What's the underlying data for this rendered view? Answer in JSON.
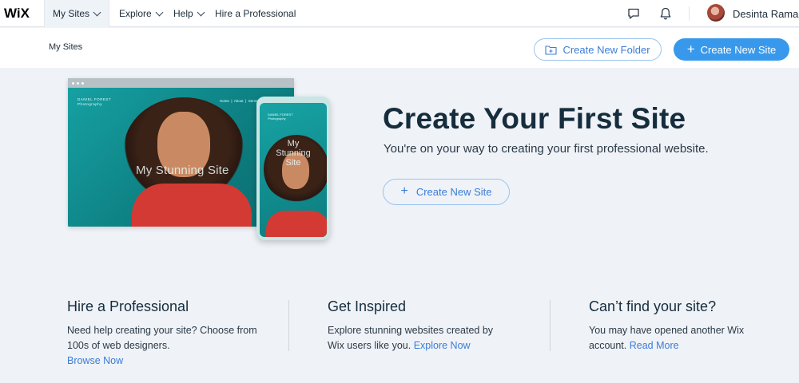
{
  "topbar": {
    "logo": "WiX",
    "nav": [
      {
        "label": "My Sites"
      },
      {
        "label": "Explore"
      },
      {
        "label": "Help"
      },
      {
        "label": "Hire a Professional"
      }
    ],
    "icons": [
      "chat-icon",
      "bell-icon"
    ],
    "user_name": "Desinta Ramad"
  },
  "subheader": {
    "breadcrumb": "My Sites",
    "create_folder": "Create New Folder",
    "create_site": "Create New Site"
  },
  "hero": {
    "preview": {
      "laptop_brand": "DANIEL FOREST\nPhotography",
      "laptop_menu": "Home  |  About  |  Services",
      "laptop_text": "My Stunning Site",
      "phone_brand": "DANIEL FOREST\nPhotography",
      "phone_text": "My\nStunning\nSite"
    },
    "title": "Create Your First Site",
    "subtitle": "You're on your way to creating your first professional website.",
    "button": "Create New Site"
  },
  "cards": [
    {
      "title": "Hire a Professional",
      "text": "Need help creating your site? Choose from 100s of web designers.",
      "link": "Browse Now"
    },
    {
      "title": "Get Inspired",
      "text": "Explore stunning websites created by Wix users like you.",
      "link": "Explore Now"
    },
    {
      "title": "Can’t find your site?",
      "text": "You may have opened another Wix account.",
      "link": "Read More"
    }
  ],
  "colors": {
    "accent": "#3899ec",
    "link": "#3b7dd6",
    "background": "#eff2f7",
    "heading": "#162d3d"
  }
}
